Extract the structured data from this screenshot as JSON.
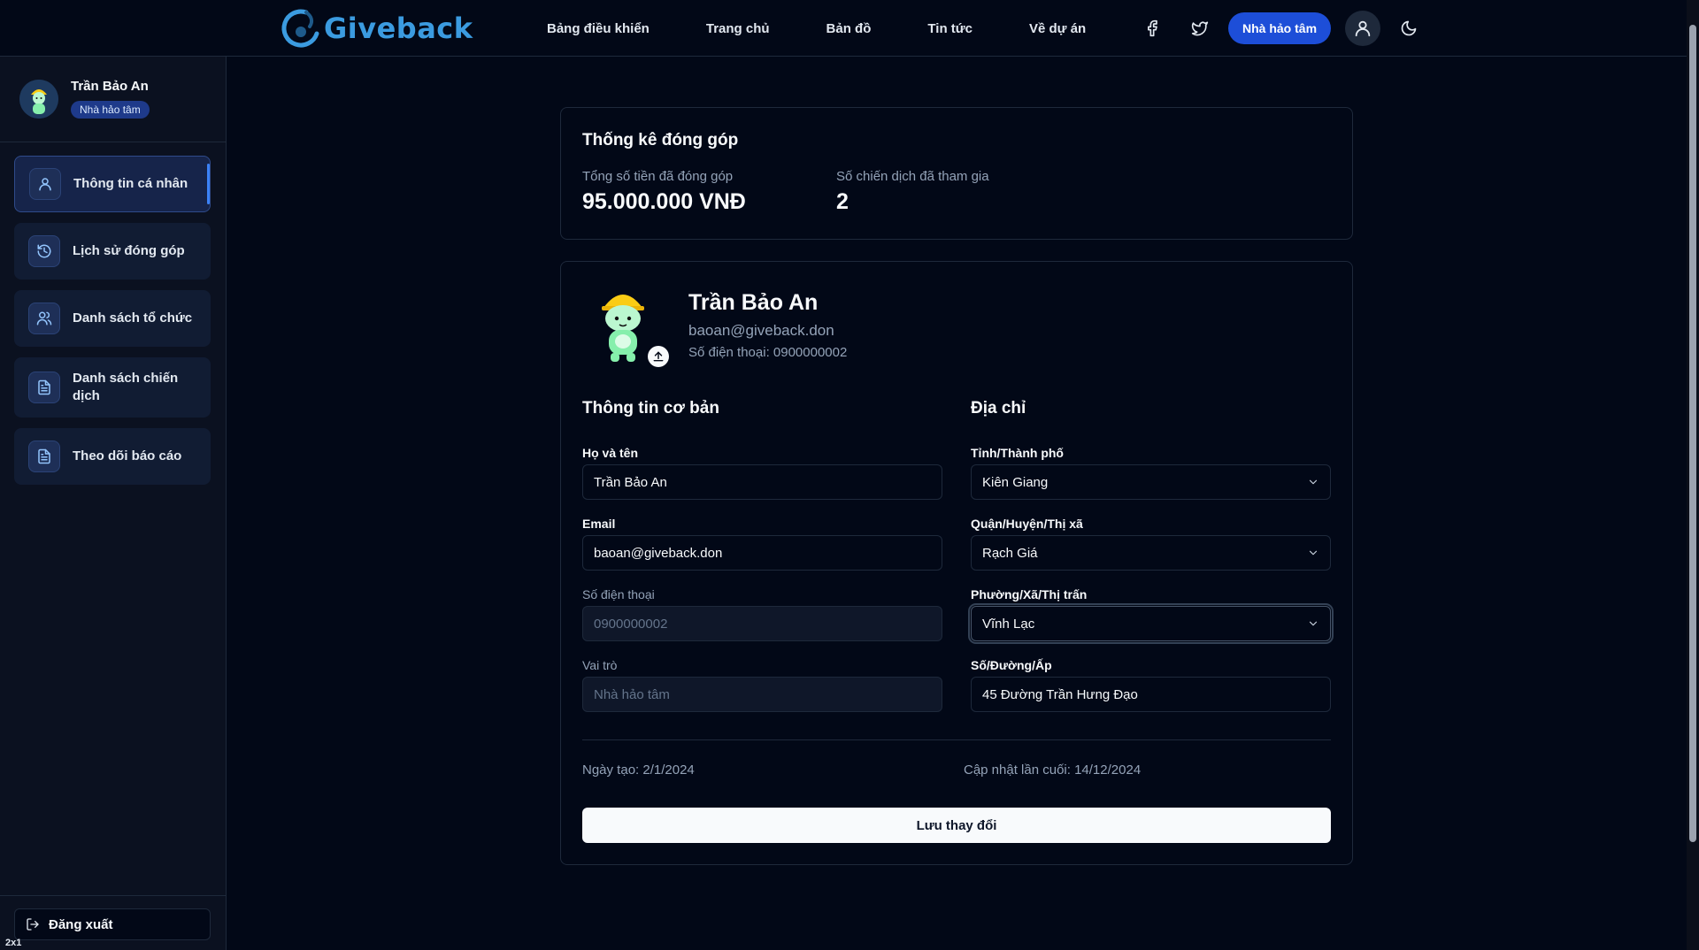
{
  "brand": {
    "name": "Giveback",
    "color": "#3b9be0"
  },
  "nav": {
    "links": [
      "Bảng điều khiển",
      "Trang chủ",
      "Bản đồ",
      "Tin tức",
      "Về dự án"
    ],
    "role_button": "Nhà hảo tâm",
    "icons": [
      "facebook-icon",
      "twitter-icon",
      "user-icon",
      "moon-icon"
    ]
  },
  "sidebar": {
    "user_name": "Trần Bảo An",
    "user_role": "Nhà hảo tâm",
    "items": [
      {
        "label": "Thông tin cá nhân",
        "icon": "user-icon",
        "active": true
      },
      {
        "label": "Lịch sử đóng góp",
        "icon": "history-icon",
        "active": false
      },
      {
        "label": "Danh sách tổ chức",
        "icon": "users-icon",
        "active": false
      },
      {
        "label": "Danh sách chiến dịch",
        "icon": "file-text-icon",
        "active": false
      },
      {
        "label": "Theo dõi báo cáo",
        "icon": "file-text-icon",
        "active": false
      }
    ],
    "logout_label": "Đăng xuất",
    "corner_tag": "2x1"
  },
  "stats": {
    "title": "Thống kê đóng góp",
    "total_label": "Tổng số tiền đã đóng góp",
    "total_value": "95.000.000 VNĐ",
    "campaigns_label": "Số chiến dịch đã tham gia",
    "campaigns_value": "2"
  },
  "profile": {
    "name": "Trần Bảo An",
    "email": "baoan@giveback.don",
    "phone_line": "Số điện thoại: 0900000002",
    "basic_title": "Thông tin cơ bản",
    "address_title": "Địa chỉ",
    "fields": {
      "fullname_label": "Họ và tên",
      "fullname_value": "Trần Bảo An",
      "email_label": "Email",
      "email_value": "baoan@giveback.don",
      "phone_label": "Số điện thoại",
      "phone_value": "0900000002",
      "role_label": "Vai trò",
      "role_value": "Nhà hảo tâm",
      "province_label": "Tỉnh/Thành phố",
      "province_value": "Kiên Giang",
      "district_label": "Quận/Huyện/Thị xã",
      "district_value": "Rạch Giá",
      "ward_label": "Phường/Xã/Thị trấn",
      "ward_value": "Vĩnh Lạc",
      "street_label": "Số/Đường/Ấp",
      "street_value": "45 Đường Trần Hưng Đạo"
    },
    "created": "Ngày tạo: 2/1/2024",
    "updated": "Cập nhật lần cuối: 14/12/2024",
    "save_label": "Lưu thay đổi"
  }
}
